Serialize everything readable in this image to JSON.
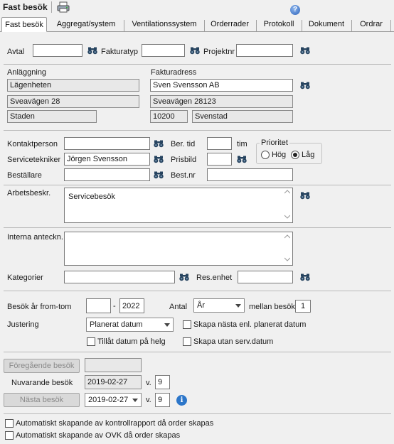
{
  "window": {
    "title": "Fast besök"
  },
  "tabs": [
    {
      "label": "Fast besök",
      "active": true
    },
    {
      "label": "Aggregat/system"
    },
    {
      "label": "Ventilationssystem"
    },
    {
      "label": "Orderrader"
    },
    {
      "label": "Protokoll"
    },
    {
      "label": "Dokument"
    },
    {
      "label": "Ordrar"
    }
  ],
  "top": {
    "avtal_label": "Avtal",
    "fakturatyp_label": "Fakturatyp",
    "projektnr_label": "Projektnr",
    "avtal": "",
    "fakturatyp": "",
    "projektnr": ""
  },
  "anlaggning": {
    "heading": "Anläggning",
    "name": "Lägenheten",
    "street": "Sveavägen 28",
    "city": "Staden"
  },
  "fakturaadress": {
    "heading": "Fakturadress",
    "name": "Sven Svensson AB",
    "street": "Sveavägen 28123",
    "zip": "10200",
    "city": "Svenstad"
  },
  "contact": {
    "kontaktperson_label": "Kontaktperson",
    "servicetekniker_label": "Servicetekniker",
    "bestallare_label": "Beställare",
    "kontaktperson": "",
    "servicetekniker": "Jörgen Svensson",
    "bestallare": "",
    "ber_tid_label": "Ber. tid",
    "tim_label": "tim",
    "prisbild_label": "Prisbild",
    "bestnr_label": "Best.nr",
    "ber_tid": "",
    "prisbild": "",
    "bestnr": ""
  },
  "prioritet": {
    "label": "Prioritet",
    "options": [
      "Hög",
      "Låg"
    ],
    "selected": "Låg"
  },
  "arbetsbeskr": {
    "label": "Arbetsbeskr.",
    "value": "Servicebesök"
  },
  "interna": {
    "label": "Interna anteckn.",
    "value": ""
  },
  "kategorier": {
    "label": "Kategorier",
    "value": "",
    "resenhet_label": "Res.enhet",
    "resenhet": ""
  },
  "schedule": {
    "besok_label": "Besök år from-tom",
    "from_year": "",
    "dash": "-",
    "to_year": "2022",
    "antal_label": "Antal",
    "antal_value": "År",
    "mellan_label": "mellan besök:",
    "mellan_value": "1",
    "justering_label": "Justering",
    "justering_value": "Planerat datum",
    "skapa_nasta_label": "Skapa nästa enl. planerat datum",
    "tillat_helg_label": "Tillåt datum på helg",
    "skapa_utan_label": "Skapa utan serv.datum"
  },
  "visits": {
    "foregaende_btn": "Föregående besök",
    "foregaende_value": "",
    "nuvarande_label": "Nuvarande besök",
    "nuvarande_date": "2019-02-27",
    "v_label": "v.",
    "nuvarande_week": "9",
    "nasta_btn": "Nästa besök",
    "nasta_date": "2019-02-27",
    "nasta_week": "9"
  },
  "auto": {
    "kontrollrapport": "Automatiskt skapande av kontrollrapport då order skapas",
    "ovk": "Automatiskt skapande av OVK då order skapas"
  },
  "icons": {
    "binoculars": "binoculars-icon",
    "print": "print-icon",
    "help": "help-icon",
    "info": "info-icon"
  }
}
